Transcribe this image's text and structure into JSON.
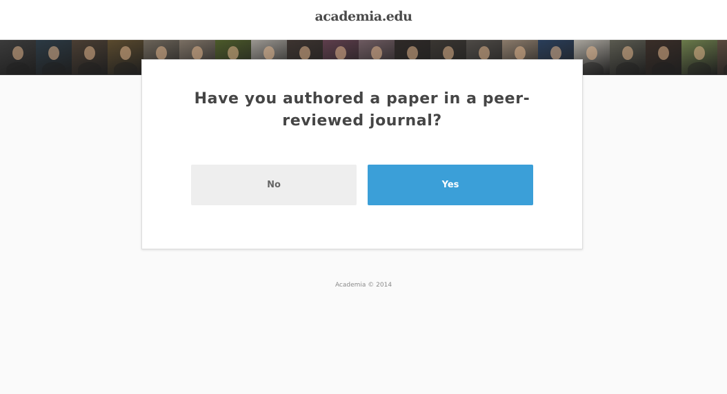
{
  "header": {
    "logo_text": "academia.edu"
  },
  "photo_strip": {
    "tile_colors": [
      "#3b3b3b",
      "#2c3a44",
      "#4a3e33",
      "#5a4a2e",
      "#6b6358",
      "#7a6f63",
      "#4c5a2a",
      "#9a9690",
      "#3d3430",
      "#5e3e4c",
      "#6d5a60",
      "#2f2a28",
      "#3a3632",
      "#4e4a46",
      "#8a7a6a",
      "#2a3e5a",
      "#a8a49c",
      "#5a5a50",
      "#3a2e28",
      "#6a7a4a",
      "#5a4a3e",
      "#3e3a38",
      "#7a3a4a",
      "#5a3a30",
      "#8a6a5a",
      "#6a5e54"
    ]
  },
  "dialog": {
    "question": "Have you authored a paper in a peer-reviewed journal?",
    "no_label": "No",
    "yes_label": "Yes"
  },
  "footer": {
    "text": "Academia © 2014"
  },
  "colors": {
    "accent": "#3b9fd8",
    "page_background": "#fafafa",
    "secondary_button": "#eeeeee"
  }
}
